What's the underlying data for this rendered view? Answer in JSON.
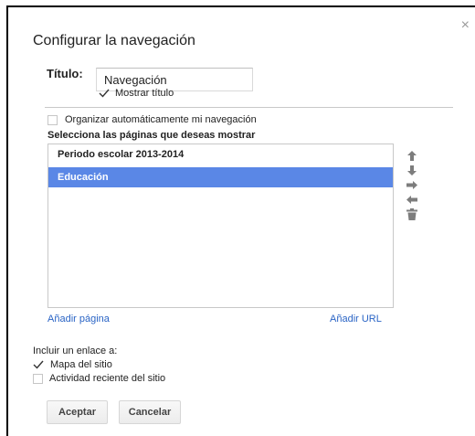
{
  "dialog": {
    "title": "Configurar la navegación",
    "close_glyph": "×"
  },
  "title_field": {
    "label": "Título:",
    "value": "Navegación",
    "show_title_label": "Mostrar título",
    "show_title_checked": true
  },
  "auto_organize": {
    "label": "Organizar automáticamente mi navegación",
    "checked": false
  },
  "pages": {
    "heading": "Selecciona las páginas que deseas mostrar",
    "items": [
      {
        "label": "Periodo escolar 2013-2014",
        "selected": false
      },
      {
        "label": "Educación",
        "selected": true
      }
    ],
    "add_page_link": "Añadir página",
    "add_url_link": "Añadir URL"
  },
  "tools": [
    "arrow-up-icon",
    "arrow-down-icon",
    "arrow-right-icon",
    "arrow-left-icon",
    "trash-icon"
  ],
  "include": {
    "label": "Incluir un enlace a:",
    "site_map_label": "Mapa del sitio",
    "site_map_checked": true,
    "recent_activity_label": "Actividad reciente del sitio",
    "recent_activity_checked": false
  },
  "buttons": {
    "accept_label": "Aceptar",
    "cancel_label": "Cancelar"
  },
  "colors": {
    "selection": "#5a87e6",
    "link": "#2a64c5"
  }
}
